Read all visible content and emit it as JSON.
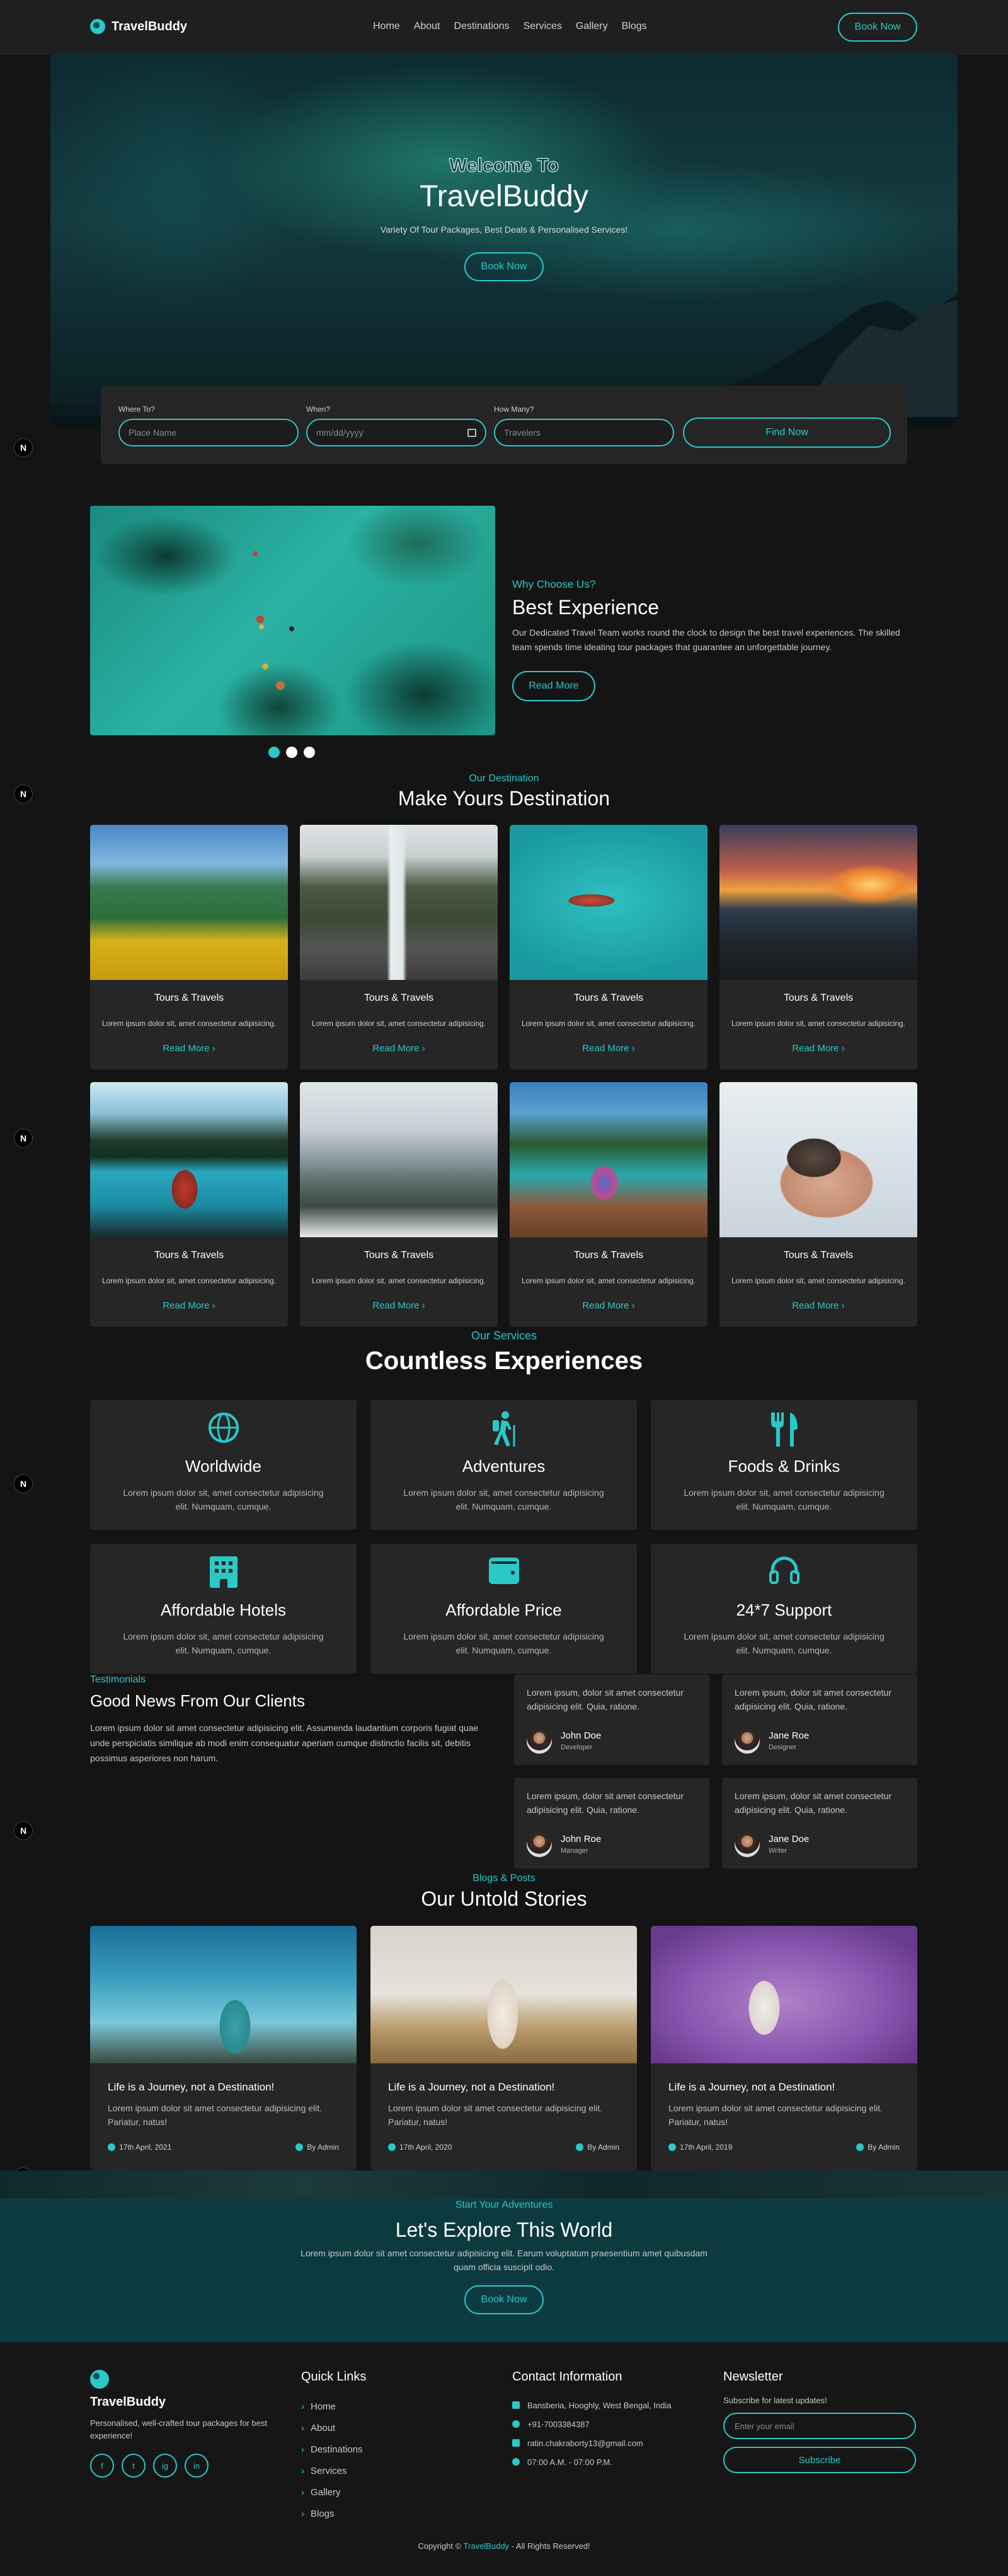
{
  "brand": {
    "name": "TravelBuddy"
  },
  "nav": {
    "items": [
      "Home",
      "About",
      "Destinations",
      "Services",
      "Gallery",
      "Blogs"
    ],
    "cta": "Book Now"
  },
  "hero": {
    "welcome": "Welcome To",
    "title": "TravelBuddy",
    "subtitle": "Variety Of Tour Packages, Best Deals & Personalised Services!",
    "cta": "Book Now"
  },
  "search": {
    "where_label": "Where To?",
    "where_placeholder": "Place Name",
    "when_label": "When?",
    "when_placeholder": "mm/dd/yyyy",
    "howmany_label": "How Many?",
    "howmany_placeholder": "Travelers",
    "submit": "Find Now"
  },
  "why": {
    "kicker": "Why Choose Us?",
    "title": "Best Experience",
    "text": "Our Dedicated Travel Team works round the clock to design the best travel experiences. The skilled team spends time ideating tour packages that guarantee an unforgettable journey.",
    "cta": "Read More",
    "carousel_dots": 3,
    "active_dot": 0
  },
  "destinations": {
    "kicker": "Our Destination",
    "title": "Make Yours Destination",
    "cards": [
      {
        "title": "Tours & Travels",
        "text": "Lorem ipsum dolor sit, amet consectetur adipisicing.",
        "link": "Read More"
      },
      {
        "title": "Tours & Travels",
        "text": "Lorem ipsum dolor sit, amet consectetur adipisicing.",
        "link": "Read More"
      },
      {
        "title": "Tours & Travels",
        "text": "Lorem ipsum dolor sit, amet consectetur adipisicing.",
        "link": "Read More"
      },
      {
        "title": "Tours & Travels",
        "text": "Lorem ipsum dolor sit, amet consectetur adipisicing.",
        "link": "Read More"
      },
      {
        "title": "Tours & Travels",
        "text": "Lorem ipsum dolor sit, amet consectetur adipisicing.",
        "link": "Read More"
      },
      {
        "title": "Tours & Travels",
        "text": "Lorem ipsum dolor sit, amet consectetur adipisicing.",
        "link": "Read More"
      },
      {
        "title": "Tours & Travels",
        "text": "Lorem ipsum dolor sit, amet consectetur adipisicing.",
        "link": "Read More"
      },
      {
        "title": "Tours & Travels",
        "text": "Lorem ipsum dolor sit, amet consectetur adipisicing.",
        "link": "Read More"
      }
    ]
  },
  "services": {
    "kicker": "Our Services",
    "title": "Countless Experiences",
    "items": [
      {
        "icon": "globe-icon",
        "title": "Worldwide",
        "text": "Lorem ipsum dolor sit, amet consectetur adipisicing elit. Numquam, cumque."
      },
      {
        "icon": "hiker-icon",
        "title": "Adventures",
        "text": "Lorem ipsum dolor sit, amet consectetur adipisicing elit. Numquam, cumque."
      },
      {
        "icon": "utensils-icon",
        "title": "Foods & Drinks",
        "text": "Lorem ipsum dolor sit, amet consectetur adipisicing elit. Numquam, cumque."
      },
      {
        "icon": "hotel-icon",
        "title": "Affordable Hotels",
        "text": "Lorem ipsum dolor sit, amet consectetur adipisicing elit. Numquam, cumque."
      },
      {
        "icon": "wallet-icon",
        "title": "Affordable Price",
        "text": "Lorem ipsum dolor sit, amet consectetur adipisicing elit. Numquam, cumque."
      },
      {
        "icon": "headset-icon",
        "title": "24*7 Support",
        "text": "Lorem ipsum dolor sit, amet consectetur adipisicing elit. Numquam, cumque."
      }
    ]
  },
  "testimonials": {
    "kicker": "Testimonials",
    "title": "Good News From Our Clients",
    "text": "Lorem ipsum dolor sit amet consectetur adipisicing elit. Assumenda laudantium corporis fugiat quae unde perspiciatis similique ab modi enim consequatur aperiam cumque distinctio facilis sit, debitis possimus asperiores non harum.",
    "items": [
      {
        "quote": "Lorem ipsum, dolor sit amet consectetur adipisicing elit. Quia, ratione.",
        "name": "John Doe",
        "role": "Developer"
      },
      {
        "quote": "Lorem ipsum, dolor sit amet consectetur adipisicing elit. Quia, ratione.",
        "name": "Jane Roe",
        "role": "Designer"
      },
      {
        "quote": "Lorem ipsum, dolor sit amet consectetur adipisicing elit. Quia, ratione.",
        "name": "John Roe",
        "role": "Manager"
      },
      {
        "quote": "Lorem ipsum, dolor sit amet consectetur adipisicing elit. Quia, ratione.",
        "name": "Jane Doe",
        "role": "Writer"
      }
    ]
  },
  "blogs": {
    "kicker": "Blogs & Posts",
    "title": "Our Untold Stories",
    "posts": [
      {
        "title": "Life is a Journey, not a Destination!",
        "text": "Lorem ipsum dolor sit amet consectetur adipisicing elit. Pariatur, natus!",
        "date": "17th April, 2021",
        "author": "By Admin"
      },
      {
        "title": "Life is a Journey, not a Destination!",
        "text": "Lorem ipsum dolor sit amet consectetur adipisicing elit. Pariatur, natus!",
        "date": "17th April, 2020",
        "author": "By Admin"
      },
      {
        "title": "Life is a Journey, not a Destination!",
        "text": "Lorem ipsum dolor sit amet consectetur adipisicing elit. Pariatur, natus!",
        "date": "17th April, 2019",
        "author": "By Admin"
      }
    ]
  },
  "cta": {
    "kicker": "Start Your Adventures",
    "title": "Let's Explore This World",
    "text": "Lorem ipsum dolor sit amet consectetur adipisicing elit. Earum voluptatum praesentium amet quibusdam quam officia suscipit odio.",
    "button": "Book Now"
  },
  "footer": {
    "brand": "TravelBuddy",
    "tagline": "Personalised, well-crafted tour packages for best experience!",
    "social": [
      "f",
      "t",
      "ig",
      "in"
    ],
    "quick_links_title": "Quick Links",
    "quick_links": [
      "Home",
      "About",
      "Destinations",
      "Services",
      "Gallery",
      "Blogs"
    ],
    "contact_title": "Contact Information",
    "contact": [
      {
        "icon": "map-icon",
        "text": "Bansberia, Hooghly, West Bengal, India"
      },
      {
        "icon": "phone-icon",
        "text": "+91-7003384387"
      },
      {
        "icon": "mail-icon",
        "text": "ratin.chakraborty13@gmail.com"
      },
      {
        "icon": "clock-icon",
        "text": "07:00 A.M. - 07:00 P.M."
      }
    ],
    "newsletter_title": "Newsletter",
    "newsletter_text": "Subscribe for latest updates!",
    "email_placeholder": "Enter your email",
    "subscribe": "Subscribe",
    "copyright_prefix": "Copyright ©",
    "copyright_brand": "TravelBuddy",
    "copyright_suffix": "- All Rights Reserved!"
  },
  "colors": {
    "accent": "#2bc8c8",
    "background": "#141414",
    "card": "#262626"
  }
}
